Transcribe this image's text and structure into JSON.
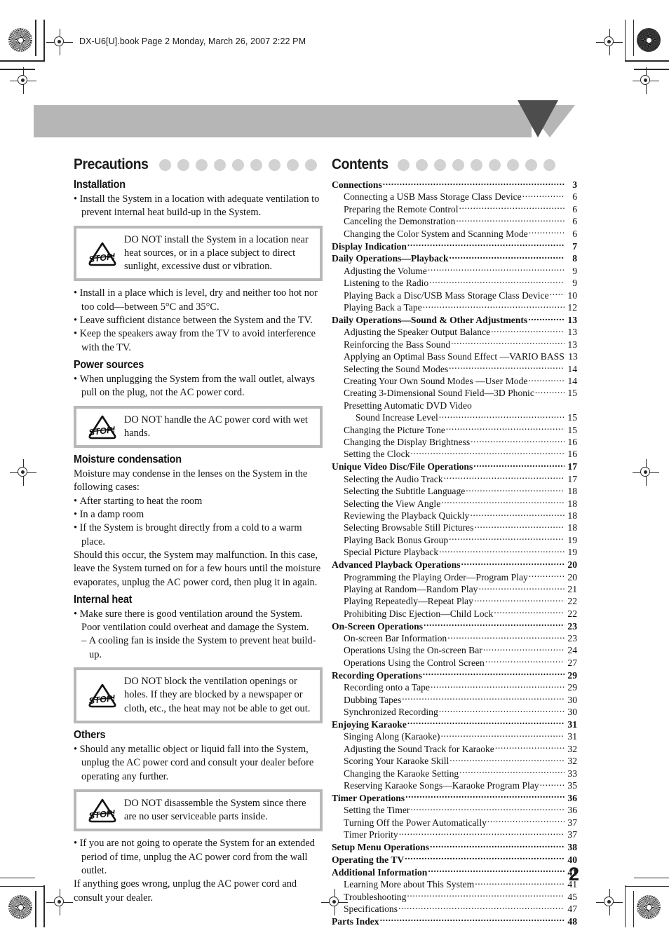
{
  "header": {
    "file_line": "DX-U6[U].book  Page 2  Monday, March 26, 2007  2:22 PM"
  },
  "page": {
    "number": "2"
  },
  "colors": {
    "banner_gray": "#b6b6b6",
    "banner_triangle_dark": "#4d4d4d",
    "dot_gray": "#d2d2d2",
    "warn_border": "#b8b8b8",
    "text": "#111111"
  },
  "precautions": {
    "title": "Precautions",
    "dot_count": 9,
    "sections": [
      {
        "heading": "Installation",
        "bullets": [
          "Install the System in a location with adequate ventilation to prevent internal heat build-up in the System."
        ],
        "warning": "DO NOT install the System in a location near heat sources, or in a place subject to direct sunlight, excessive dust or vibration.",
        "bullets_after": [
          "Install in a place which is level, dry and neither too hot nor too cold—between 5°C and 35°C.",
          "Leave sufficient distance between the System and the TV.",
          "Keep the speakers away from the TV to avoid interference with the TV."
        ]
      },
      {
        "heading": "Power sources",
        "bullets": [
          "When unplugging the System from the wall outlet, always pull on the plug, not the AC power cord."
        ],
        "warning": "DO NOT handle the AC power cord with wet hands."
      },
      {
        "heading": "Moisture condensation",
        "intro": "Moisture may condense in the lenses on the System in the following cases:",
        "bullets": [
          "After starting to heat the room",
          "In a damp room",
          "If the System is brought directly from a cold to a warm place."
        ],
        "outro": "Should this occur, the System may malfunction. In this case, leave the System turned on for a few hours until the moisture evaporates, unplug the AC power cord, then plug it in again."
      },
      {
        "heading": "Internal heat",
        "bullets": [
          "Make sure there is good ventilation around the System. Poor ventilation could overheat and damage the System."
        ],
        "sub_bullets": [
          "A cooling fan is inside the System to prevent heat build-up."
        ],
        "warning": "DO NOT block the ventilation openings or holes. If they are blocked by a newspaper or cloth, etc., the heat may not be able to get out."
      },
      {
        "heading": "Others",
        "bullets": [
          "Should any metallic object or liquid fall into the System, unplug the AC power cord and consult your dealer before operating any further."
        ],
        "warning": "DO NOT disassemble the System since there are no user serviceable parts inside.",
        "bullets_after": [
          "If you are not going to operate the System for an extended period of time, unplug the AC power cord from the wall outlet."
        ],
        "outro": "If anything goes wrong, unplug the AC power cord and consult your dealer."
      }
    ],
    "warning_icon_label": "STOP!"
  },
  "contents": {
    "title": "Contents",
    "dot_count": 9,
    "entries": [
      {
        "level": 1,
        "label": "Connections",
        "page": "3"
      },
      {
        "level": 2,
        "label": "Connecting a USB Mass Storage Class Device",
        "page": "6"
      },
      {
        "level": 2,
        "label": "Preparing the Remote Control",
        "page": "6"
      },
      {
        "level": 2,
        "label": "Canceling the Demonstration",
        "page": "6"
      },
      {
        "level": 2,
        "label": "Changing the Color System and Scanning Mode",
        "page": "6"
      },
      {
        "level": 1,
        "label": "Display Indication",
        "page": "7"
      },
      {
        "level": 1,
        "label": "Daily Operations—Playback",
        "page": "8"
      },
      {
        "level": 2,
        "label": "Adjusting the Volume",
        "page": "9"
      },
      {
        "level": 2,
        "label": "Listening to the Radio",
        "page": "9"
      },
      {
        "level": 2,
        "label": "Playing Back a Disc/USB Mass Storage Class Device",
        "page": "10"
      },
      {
        "level": 2,
        "label": "Playing Back a Tape",
        "page": "12"
      },
      {
        "level": 1,
        "label": "Daily Operations—Sound & Other Adjustments",
        "page": "13"
      },
      {
        "level": 2,
        "label": "Adjusting the Speaker Output Balance",
        "page": "13"
      },
      {
        "level": 2,
        "label": "Reinforcing the Bass Sound",
        "page": "13"
      },
      {
        "level": 2,
        "label": "Applying an Optimal Bass Sound Effect —VARIO BASS",
        "page": "13"
      },
      {
        "level": 2,
        "label": "Selecting the Sound Modes",
        "page": "14"
      },
      {
        "level": 2,
        "label": "Creating Your Own Sound Modes —User Mode",
        "page": "14"
      },
      {
        "level": 2,
        "label": "Creating 3-Dimensional Sound Field—3D Phonic",
        "page": "15"
      },
      {
        "level": 2,
        "label": "Presetting Automatic DVD Video",
        "page": "",
        "noleader": true
      },
      {
        "level": 3,
        "label": "Sound Increase Level",
        "page": "15"
      },
      {
        "level": 2,
        "label": "Changing the Picture Tone",
        "page": "15"
      },
      {
        "level": 2,
        "label": "Changing the Display Brightness",
        "page": "16"
      },
      {
        "level": 2,
        "label": "Setting the Clock",
        "page": "16"
      },
      {
        "level": 1,
        "label": "Unique Video Disc/File Operations",
        "page": "17"
      },
      {
        "level": 2,
        "label": "Selecting the Audio Track",
        "page": "17"
      },
      {
        "level": 2,
        "label": "Selecting the Subtitle Language",
        "page": "18"
      },
      {
        "level": 2,
        "label": "Selecting the View Angle",
        "page": "18"
      },
      {
        "level": 2,
        "label": "Reviewing the Playback Quickly",
        "page": "18"
      },
      {
        "level": 2,
        "label": "Selecting Browsable Still Pictures",
        "page": "18"
      },
      {
        "level": 2,
        "label": "Playing Back Bonus Group",
        "page": "19"
      },
      {
        "level": 2,
        "label": "Special Picture Playback",
        "page": "19"
      },
      {
        "level": 1,
        "label": "Advanced Playback Operations",
        "page": "20"
      },
      {
        "level": 2,
        "label": "Programming the Playing Order—Program Play",
        "page": "20"
      },
      {
        "level": 2,
        "label": "Playing at Random—Random Play",
        "page": "21"
      },
      {
        "level": 2,
        "label": "Playing Repeatedly—Repeat Play",
        "page": "22"
      },
      {
        "level": 2,
        "label": "Prohibiting Disc Ejection—Child Lock",
        "page": "22"
      },
      {
        "level": 1,
        "label": "On-Screen Operations",
        "page": "23"
      },
      {
        "level": 2,
        "label": "On-screen Bar Information",
        "page": "23"
      },
      {
        "level": 2,
        "label": "Operations Using the On-screen Bar",
        "page": "24"
      },
      {
        "level": 2,
        "label": "Operations Using the Control Screen",
        "page": "27"
      },
      {
        "level": 1,
        "label": "Recording Operations",
        "page": "29"
      },
      {
        "level": 2,
        "label": "Recording onto a Tape",
        "page": "29"
      },
      {
        "level": 2,
        "label": "Dubbing Tapes",
        "page": "30"
      },
      {
        "level": 2,
        "label": "Synchronized Recording",
        "page": "30"
      },
      {
        "level": 1,
        "label": "Enjoying Karaoke",
        "page": "31"
      },
      {
        "level": 2,
        "label": "Singing Along (Karaoke)",
        "page": "31"
      },
      {
        "level": 2,
        "label": "Adjusting the Sound Track for Karaoke",
        "page": "32"
      },
      {
        "level": 2,
        "label": "Scoring Your Karaoke Skill",
        "page": "32"
      },
      {
        "level": 2,
        "label": "Changing the Karaoke Setting",
        "page": "33"
      },
      {
        "level": 2,
        "label": "Reserving Karaoke Songs—Karaoke Program Play",
        "page": "35"
      },
      {
        "level": 1,
        "label": "Timer Operations",
        "page": "36"
      },
      {
        "level": 2,
        "label": "Setting the Timer",
        "page": "36"
      },
      {
        "level": 2,
        "label": "Turning Off the Power Automatically",
        "page": "37"
      },
      {
        "level": 2,
        "label": "Timer Priority",
        "page": "37"
      },
      {
        "level": 1,
        "label": "Setup Menu Operations",
        "page": "38"
      },
      {
        "level": 1,
        "label": "Operating the TV",
        "page": "40"
      },
      {
        "level": 1,
        "label": "Additional Information",
        "page": "41"
      },
      {
        "level": 2,
        "label": "Learning More about This System",
        "page": "41"
      },
      {
        "level": 2,
        "label": "Troubleshooting",
        "page": "45"
      },
      {
        "level": 2,
        "label": "Specifications",
        "page": "47"
      },
      {
        "level": 1,
        "label": "Parts Index",
        "page": "48"
      }
    ]
  }
}
